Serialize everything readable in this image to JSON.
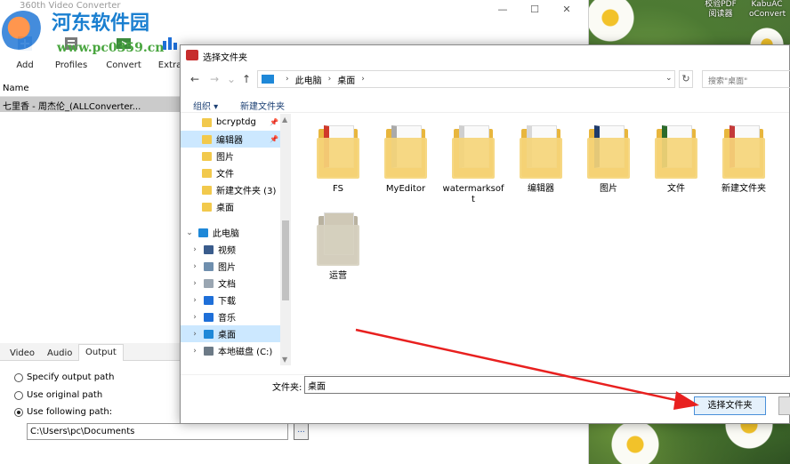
{
  "app": {
    "title": "360th Video Converter",
    "toolbar": [
      "Add",
      "Profiles",
      "Convert",
      "Extra"
    ],
    "list_header": "Name",
    "list_row": "七里香 - 周杰伦_(ALLConverter...",
    "tabs": [
      "Video",
      "Audio",
      "Output"
    ],
    "active_tab": "Output",
    "output": {
      "specify": "Specify output path",
      "original": "Use original path",
      "following": "Use following path:",
      "path_value": "C:\\Users\\pc\\Documents",
      "browse": "..."
    },
    "window_buttons": [
      "—",
      "☐",
      "✕"
    ]
  },
  "watermark": {
    "title": "河东软件园",
    "url": "www.pc0359.cn"
  },
  "desktop_icons": [
    {
      "label": "校验PDF阅读器"
    },
    {
      "label": "KabuAC oConvert"
    }
  ],
  "dialog": {
    "title": "选择文件夹",
    "address": [
      "此电脑",
      "桌面"
    ],
    "search_placeholder": "搜索\"桌面\"",
    "commands": [
      "组织 ▾",
      "新建文件夹"
    ],
    "quick_access": [
      {
        "label": "bcryptdg",
        "pinned": true
      },
      {
        "label": "编辑器",
        "pinned": true,
        "selected": true
      },
      {
        "label": "图片"
      },
      {
        "label": "文件"
      },
      {
        "label": "新建文件夹 (3)"
      },
      {
        "label": "桌面"
      }
    ],
    "this_pc_label": "此电脑",
    "this_pc_items": [
      {
        "label": "视频",
        "color": "#3a5c8c"
      },
      {
        "label": "图片",
        "color": "#6f8fae"
      },
      {
        "label": "文档",
        "color": "#9aa6b2"
      },
      {
        "label": "下载",
        "color": "#1e6fd8"
      },
      {
        "label": "音乐",
        "color": "#1e6fd8"
      },
      {
        "label": "桌面",
        "color": "#1e88d8",
        "selected": true
      },
      {
        "label": "本地磁盘 (C:)",
        "color": "#6c7a86"
      }
    ],
    "files": [
      {
        "name": "FS",
        "accent": "#d03a2a"
      },
      {
        "name": "MyEditor",
        "accent": "#aaaaaa"
      },
      {
        "name": "watermarksoft",
        "accent": "#cfcfcf"
      },
      {
        "name": "编辑器",
        "accent": "#d8d8d8"
      },
      {
        "name": "图片",
        "accent": "#1f3b6b"
      },
      {
        "name": "文件",
        "accent": "#2c6b2c"
      },
      {
        "name": "新建文件夹",
        "accent": "#c43a3a"
      },
      {
        "name": "运营",
        "accent": "#8a8a8a"
      }
    ],
    "folder_label": "文件夹:",
    "folder_value": "桌面",
    "select_button": "选择文件夹"
  }
}
